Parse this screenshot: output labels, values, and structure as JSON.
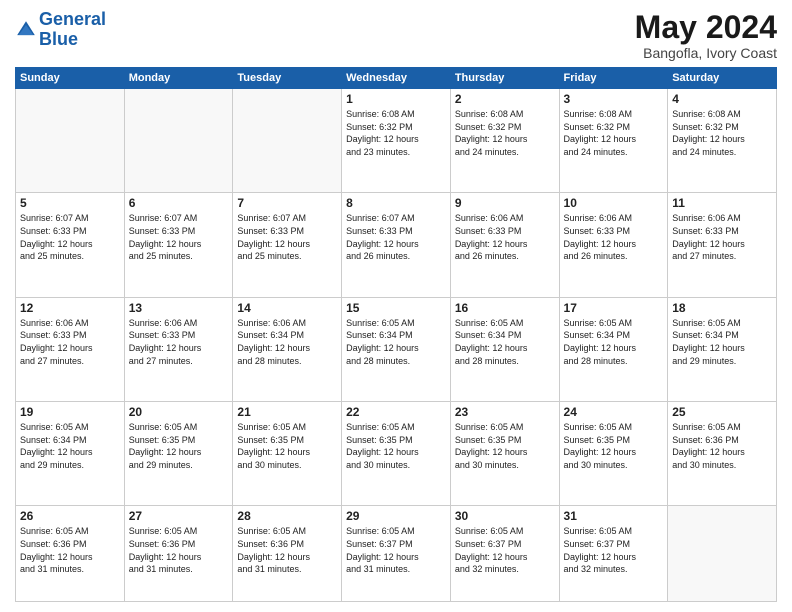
{
  "header": {
    "logo_line1": "General",
    "logo_line2": "Blue",
    "month_year": "May 2024",
    "location": "Bangofla, Ivory Coast"
  },
  "days_of_week": [
    "Sunday",
    "Monday",
    "Tuesday",
    "Wednesday",
    "Thursday",
    "Friday",
    "Saturday"
  ],
  "weeks": [
    [
      {
        "day": "",
        "content": ""
      },
      {
        "day": "",
        "content": ""
      },
      {
        "day": "",
        "content": ""
      },
      {
        "day": "1",
        "content": "Sunrise: 6:08 AM\nSunset: 6:32 PM\nDaylight: 12 hours\nand 23 minutes."
      },
      {
        "day": "2",
        "content": "Sunrise: 6:08 AM\nSunset: 6:32 PM\nDaylight: 12 hours\nand 24 minutes."
      },
      {
        "day": "3",
        "content": "Sunrise: 6:08 AM\nSunset: 6:32 PM\nDaylight: 12 hours\nand 24 minutes."
      },
      {
        "day": "4",
        "content": "Sunrise: 6:08 AM\nSunset: 6:32 PM\nDaylight: 12 hours\nand 24 minutes."
      }
    ],
    [
      {
        "day": "5",
        "content": "Sunrise: 6:07 AM\nSunset: 6:33 PM\nDaylight: 12 hours\nand 25 minutes."
      },
      {
        "day": "6",
        "content": "Sunrise: 6:07 AM\nSunset: 6:33 PM\nDaylight: 12 hours\nand 25 minutes."
      },
      {
        "day": "7",
        "content": "Sunrise: 6:07 AM\nSunset: 6:33 PM\nDaylight: 12 hours\nand 25 minutes."
      },
      {
        "day": "8",
        "content": "Sunrise: 6:07 AM\nSunset: 6:33 PM\nDaylight: 12 hours\nand 26 minutes."
      },
      {
        "day": "9",
        "content": "Sunrise: 6:06 AM\nSunset: 6:33 PM\nDaylight: 12 hours\nand 26 minutes."
      },
      {
        "day": "10",
        "content": "Sunrise: 6:06 AM\nSunset: 6:33 PM\nDaylight: 12 hours\nand 26 minutes."
      },
      {
        "day": "11",
        "content": "Sunrise: 6:06 AM\nSunset: 6:33 PM\nDaylight: 12 hours\nand 27 minutes."
      }
    ],
    [
      {
        "day": "12",
        "content": "Sunrise: 6:06 AM\nSunset: 6:33 PM\nDaylight: 12 hours\nand 27 minutes."
      },
      {
        "day": "13",
        "content": "Sunrise: 6:06 AM\nSunset: 6:33 PM\nDaylight: 12 hours\nand 27 minutes."
      },
      {
        "day": "14",
        "content": "Sunrise: 6:06 AM\nSunset: 6:34 PM\nDaylight: 12 hours\nand 28 minutes."
      },
      {
        "day": "15",
        "content": "Sunrise: 6:05 AM\nSunset: 6:34 PM\nDaylight: 12 hours\nand 28 minutes."
      },
      {
        "day": "16",
        "content": "Sunrise: 6:05 AM\nSunset: 6:34 PM\nDaylight: 12 hours\nand 28 minutes."
      },
      {
        "day": "17",
        "content": "Sunrise: 6:05 AM\nSunset: 6:34 PM\nDaylight: 12 hours\nand 28 minutes."
      },
      {
        "day": "18",
        "content": "Sunrise: 6:05 AM\nSunset: 6:34 PM\nDaylight: 12 hours\nand 29 minutes."
      }
    ],
    [
      {
        "day": "19",
        "content": "Sunrise: 6:05 AM\nSunset: 6:34 PM\nDaylight: 12 hours\nand 29 minutes."
      },
      {
        "day": "20",
        "content": "Sunrise: 6:05 AM\nSunset: 6:35 PM\nDaylight: 12 hours\nand 29 minutes."
      },
      {
        "day": "21",
        "content": "Sunrise: 6:05 AM\nSunset: 6:35 PM\nDaylight: 12 hours\nand 30 minutes."
      },
      {
        "day": "22",
        "content": "Sunrise: 6:05 AM\nSunset: 6:35 PM\nDaylight: 12 hours\nand 30 minutes."
      },
      {
        "day": "23",
        "content": "Sunrise: 6:05 AM\nSunset: 6:35 PM\nDaylight: 12 hours\nand 30 minutes."
      },
      {
        "day": "24",
        "content": "Sunrise: 6:05 AM\nSunset: 6:35 PM\nDaylight: 12 hours\nand 30 minutes."
      },
      {
        "day": "25",
        "content": "Sunrise: 6:05 AM\nSunset: 6:36 PM\nDaylight: 12 hours\nand 30 minutes."
      }
    ],
    [
      {
        "day": "26",
        "content": "Sunrise: 6:05 AM\nSunset: 6:36 PM\nDaylight: 12 hours\nand 31 minutes."
      },
      {
        "day": "27",
        "content": "Sunrise: 6:05 AM\nSunset: 6:36 PM\nDaylight: 12 hours\nand 31 minutes."
      },
      {
        "day": "28",
        "content": "Sunrise: 6:05 AM\nSunset: 6:36 PM\nDaylight: 12 hours\nand 31 minutes."
      },
      {
        "day": "29",
        "content": "Sunrise: 6:05 AM\nSunset: 6:37 PM\nDaylight: 12 hours\nand 31 minutes."
      },
      {
        "day": "30",
        "content": "Sunrise: 6:05 AM\nSunset: 6:37 PM\nDaylight: 12 hours\nand 32 minutes."
      },
      {
        "day": "31",
        "content": "Sunrise: 6:05 AM\nSunset: 6:37 PM\nDaylight: 12 hours\nand 32 minutes."
      },
      {
        "day": "",
        "content": ""
      }
    ]
  ]
}
